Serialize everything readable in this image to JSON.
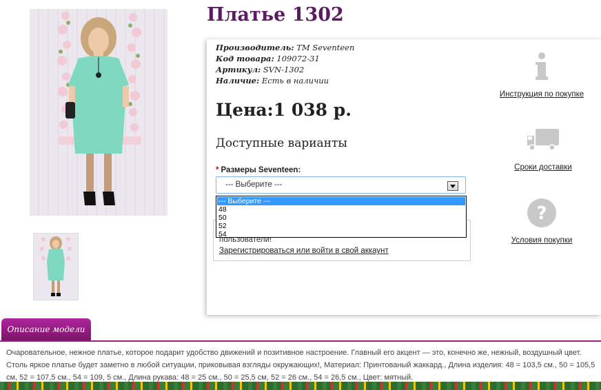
{
  "product": {
    "title": "Платье 1302",
    "info": [
      {
        "label": "Производитель:",
        "value": "TM Seventeen"
      },
      {
        "label": "Код товара:",
        "value": "109072-31"
      },
      {
        "label": "Артикул:",
        "value": "SVN-1302"
      },
      {
        "label": "Наличие:",
        "value": "Есть в наличии"
      }
    ],
    "price": "Цена:1 038 р."
  },
  "variants": {
    "title": "Доступные варианты",
    "size_label": "Размеры Seventeen:",
    "required_mark": "*",
    "selected": "--- Выберите ---",
    "options": [
      "--- Выберите ---",
      "48",
      "50",
      "52",
      "54"
    ]
  },
  "login": {
    "message": "пользователи!",
    "link": "Зарегистрироваться или войти в свой аккаунт"
  },
  "side": [
    {
      "icon": "info-icon",
      "label": "Инструкция по покупке"
    },
    {
      "icon": "truck-icon",
      "label": "Сроки доставки"
    },
    {
      "icon": "question-icon",
      "label": "Условия покупки"
    }
  ],
  "description": {
    "tab": "Описание модели",
    "text": "Очаровательное, нежное платье, которое подарит удобство движений и позитивное настроение. Главный его акцент — это, конечно же, нежный, воздушный цвет. Столь яркое платье будет заметно в любой ситуации, приковывая взгляды окружающих!, Материал: Принтованый жаккард., Длина изделия: 48 = 103,5 см., 50 = 105,5 см, 52 = 107,5 см., 54 = 109, 5 см., Длина рукава: 48 = 25 см., 50 = 25,5 см, 52 = 26 см., 54 = 26,5 см., Цвет: мятный."
  },
  "colors": {
    "title": "#5b1a63",
    "tab": "#9b1f88",
    "dress": "#7fd8c0",
    "select_highlight": "#3399ff"
  }
}
